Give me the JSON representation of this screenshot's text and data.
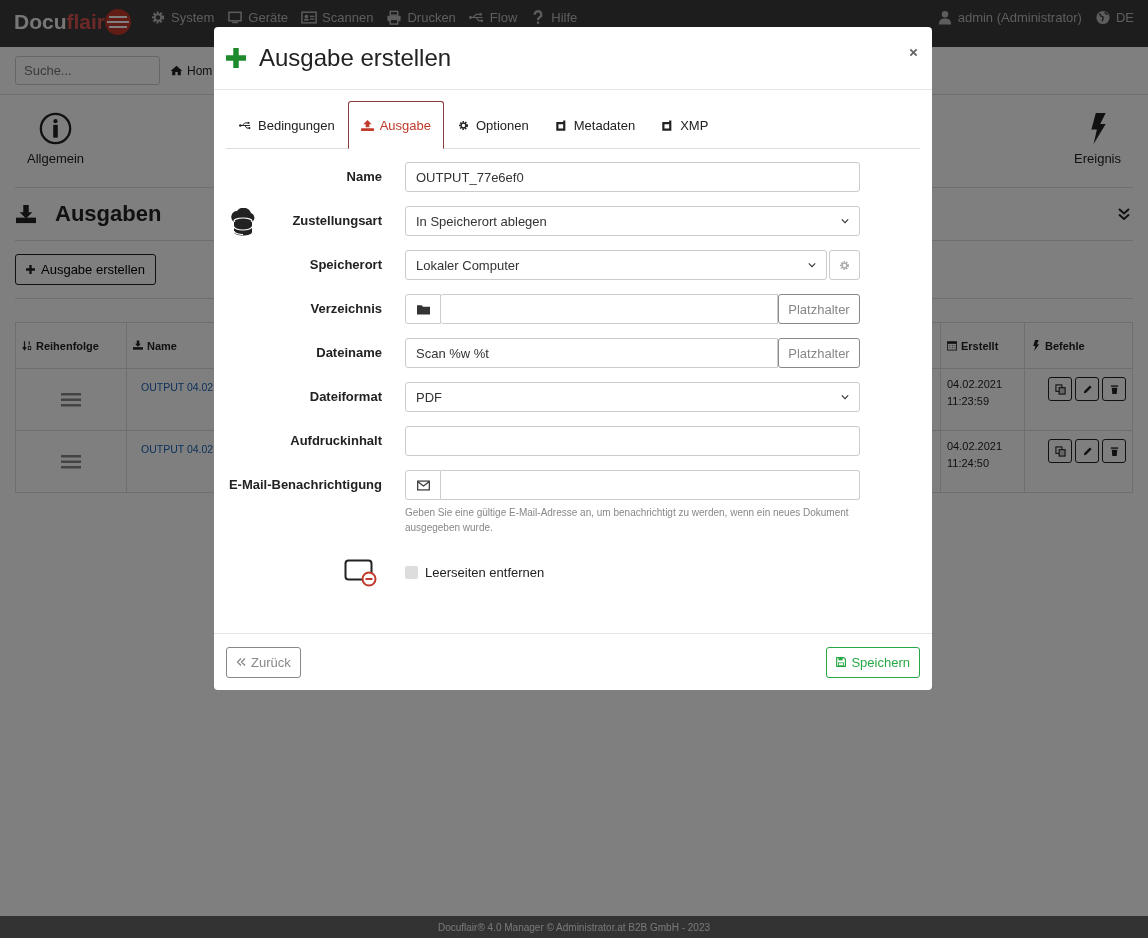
{
  "navbar": {
    "logo": [
      "Docu",
      "flair"
    ],
    "menu": [
      {
        "label": "System"
      },
      {
        "label": "Geräte"
      },
      {
        "label": "Scannen"
      },
      {
        "label": "Drucken"
      },
      {
        "label": "Flow"
      },
      {
        "label": "Hilfe"
      }
    ],
    "user": "admin (Administrator)",
    "language": "DE"
  },
  "search": {
    "placeholder": "Suche..."
  },
  "breadcrumb": "Hom",
  "toolbar": [
    {
      "label": "Allgemein"
    },
    {
      "label": "Ereignis"
    }
  ],
  "section": {
    "title": "Ausgaben"
  },
  "create_button": "Ausgabe erstellen",
  "table": {
    "columns": [
      "Reihenfolge",
      "Name",
      "Erstellt",
      "Befehle"
    ],
    "rows": [
      {
        "name": "OUTPUT 04.02",
        "created": [
          "04.02.2021",
          "11:23:59"
        ]
      },
      {
        "name": "OUTPUT 04.02",
        "created": [
          "04.02.2021",
          "11:24:50"
        ]
      }
    ]
  },
  "modal": {
    "title": "Ausgabe erstellen",
    "tabs": [
      {
        "label": "Bedingungen",
        "selected": false
      },
      {
        "label": "Ausgabe",
        "selected": true
      },
      {
        "label": "Optionen",
        "selected": false
      },
      {
        "label": "Metadaten",
        "selected": false
      },
      {
        "label": "XMP",
        "selected": false
      }
    ],
    "fields": [
      {
        "kind": "text",
        "label": "Name",
        "value": "OUTPUT_77e6ef0"
      },
      {
        "kind": "delivery-select",
        "label": "Zustellungsart",
        "value": "In Speicherort ablegen"
      },
      {
        "kind": "location-select",
        "label": "Speicherort",
        "value": "Lokaler Computer"
      },
      {
        "kind": "folder-text",
        "label": "Verzeichnis",
        "button": "Platzhalter"
      },
      {
        "kind": "text",
        "label": "Dateiname",
        "value": "Scan %w %t",
        "button": "Platzhalter"
      },
      {
        "kind": "select",
        "label": "Dateiformat",
        "value": "PDF"
      },
      {
        "kind": "text",
        "label": "Aufdruckinhalt"
      },
      {
        "kind": "email",
        "label": "E-Mail-Benachrichtigung",
        "help": "Geben Sie eine gültige E-Mail-Adresse an, um benachrichtigt zu werden, wenn ein neues Dokument ausgegeben wurde."
      }
    ],
    "checkbox": {
      "label": "Leerseiten entfernen",
      "checked": false
    },
    "back_button": "Zurück",
    "save_button": "Speichern"
  },
  "footer": "Docuflair® 4.0 Manager © Administrator.at B2B GmbH - 2023"
}
